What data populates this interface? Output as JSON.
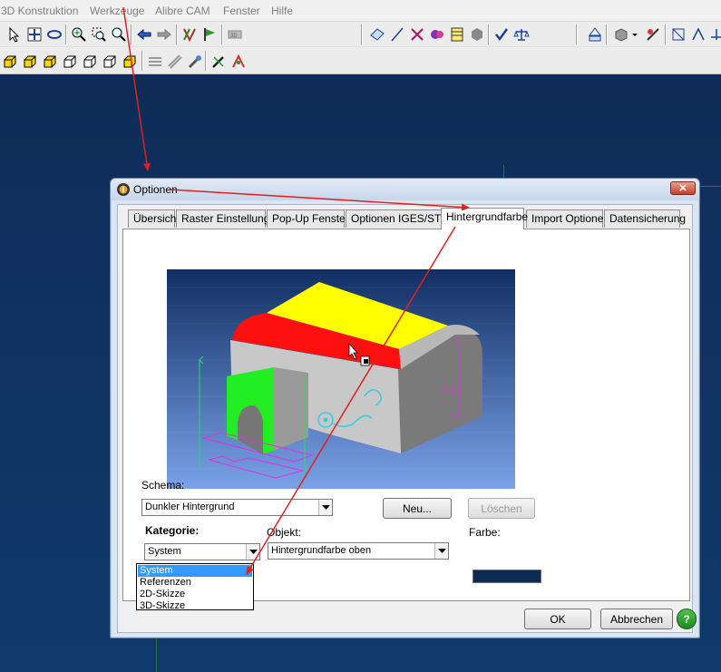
{
  "menu": {
    "items": [
      "3D Konstruktion",
      "Werkzeuge",
      "Alibre CAM",
      "Fenster",
      "Hilfe"
    ]
  },
  "dialog": {
    "title": "Optionen",
    "close_label": "✕",
    "tabs": [
      "Übersicht",
      "Raster Einstellung",
      "Pop-Up Fenster",
      "Optionen IGES/STL",
      "Hintergrundfarbe",
      "Import Optionen",
      "Datensicherung"
    ],
    "active_tab": "Hintergrundfarbe",
    "preview_dimension_label": "5.0",
    "schema_label": "Schema:",
    "schema_value": "Dunkler Hintergrund",
    "new_button": "Neu...",
    "delete_button": "Löschen",
    "kategorie_label": "Kategorie:",
    "kategorie_value": "System",
    "objekt_label": "Objekt:",
    "objekt_value": "Hintergrundfarbe oben",
    "farbe_label": "Farbe:",
    "farbe_color": "#0c2a52",
    "kategorie_options": [
      "System",
      "Referenzen",
      "2D-Skizze",
      "3D-Skizze"
    ],
    "ok_button": "OK",
    "cancel_button": "Abbrechen",
    "help_icon": "?"
  },
  "colors": {
    "canvas_background": "#0f3464",
    "annotation_arrows": "#e02020",
    "preview_highlight_yellow": "#ffff00",
    "preview_highlight_red": "#ff0000",
    "preview_feature_green": "#00ff00"
  }
}
